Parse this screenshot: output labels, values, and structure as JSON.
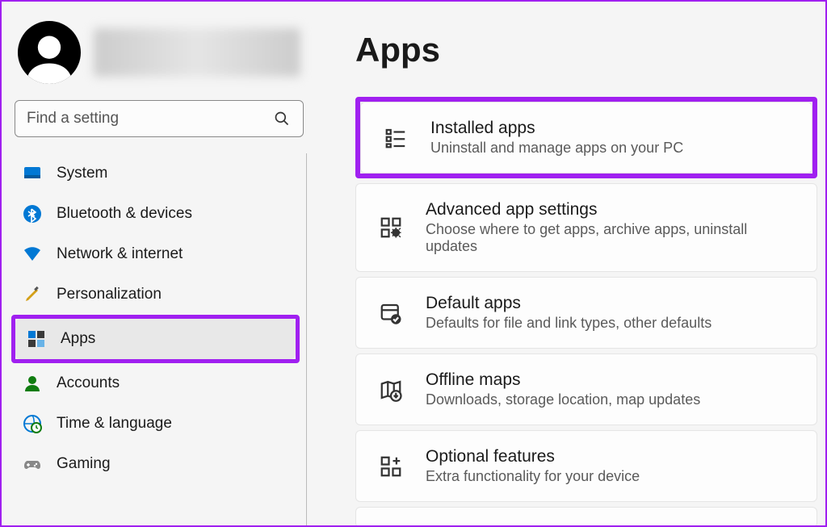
{
  "search": {
    "placeholder": "Find a setting"
  },
  "page": {
    "title": "Apps"
  },
  "sidebar": {
    "items": [
      {
        "label": "System"
      },
      {
        "label": "Bluetooth & devices"
      },
      {
        "label": "Network & internet"
      },
      {
        "label": "Personalization"
      },
      {
        "label": "Apps"
      },
      {
        "label": "Accounts"
      },
      {
        "label": "Time & language"
      },
      {
        "label": "Gaming"
      }
    ]
  },
  "cards": [
    {
      "title": "Installed apps",
      "sub": "Uninstall and manage apps on your PC"
    },
    {
      "title": "Advanced app settings",
      "sub": "Choose where to get apps, archive apps, uninstall updates"
    },
    {
      "title": "Default apps",
      "sub": "Defaults for file and link types, other defaults"
    },
    {
      "title": "Offline maps",
      "sub": "Downloads, storage location, map updates"
    },
    {
      "title": "Optional features",
      "sub": "Extra functionality for your device"
    }
  ]
}
